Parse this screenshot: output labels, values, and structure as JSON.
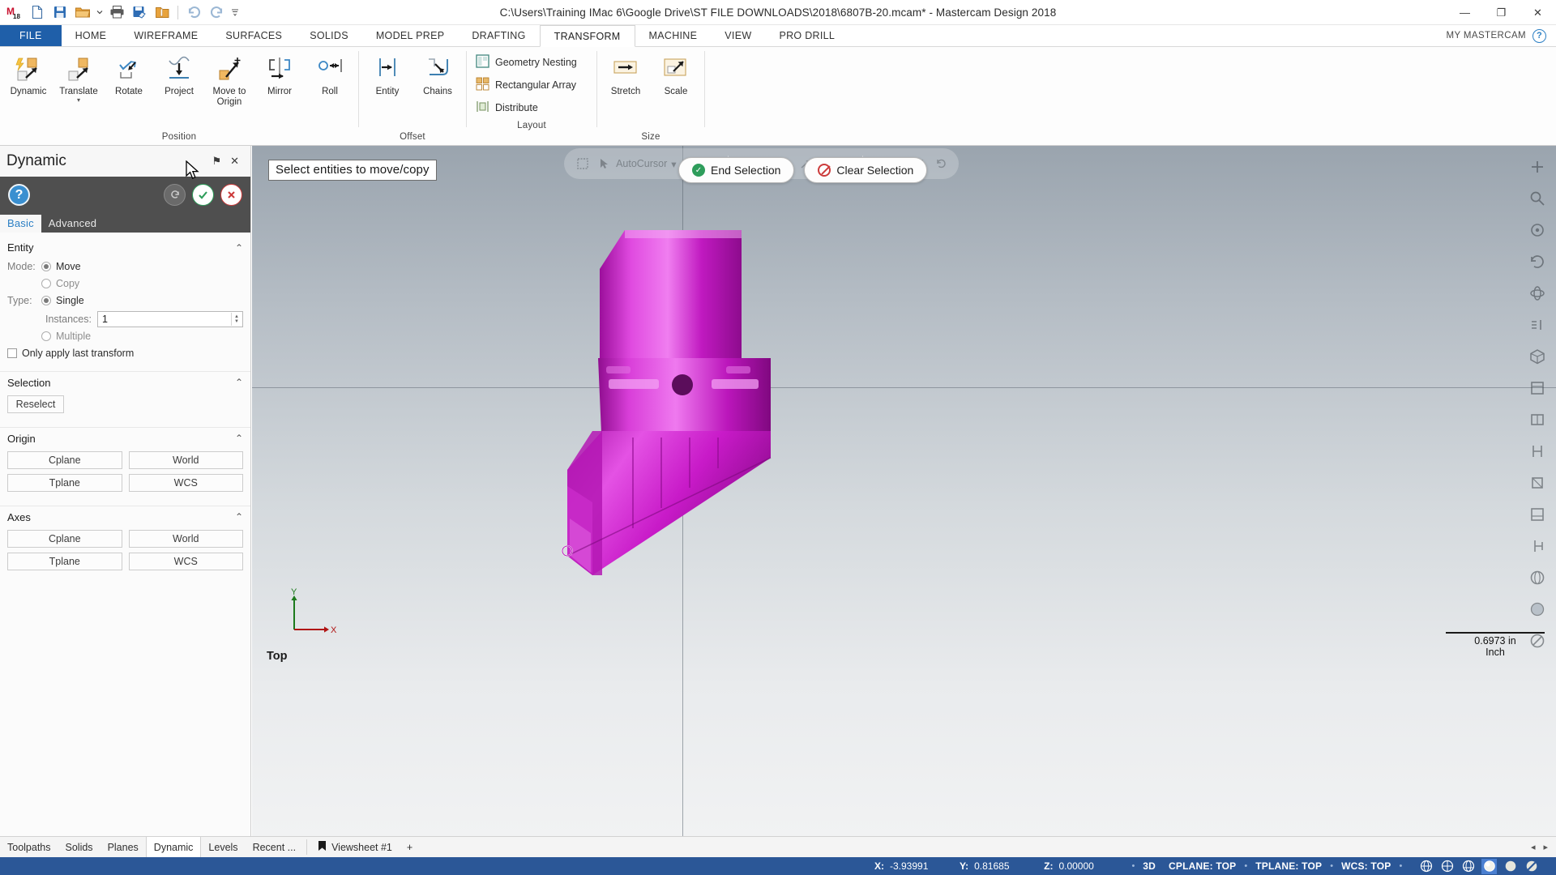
{
  "window": {
    "title": "C:\\Users\\Training IMac 6\\Google Drive\\ST FILE DOWNLOADS\\2018\\6807B-20.mcam* - Mastercam Design 2018",
    "minimize": "—",
    "maximize": "❐",
    "close": "✕"
  },
  "quick_access": [
    {
      "name": "mastercam-logo-icon",
      "label": "Mastercam 2018"
    },
    {
      "name": "new-file-icon",
      "label": "New"
    },
    {
      "name": "save-icon",
      "label": "Save"
    },
    {
      "name": "open-folder-icon",
      "label": "Open"
    },
    {
      "name": "open-dropdown-icon",
      "label": "Open recent"
    },
    {
      "name": "print-icon",
      "label": "Print"
    },
    {
      "name": "save-as-icon",
      "label": "Save As"
    },
    {
      "name": "zip2go-icon",
      "label": "Zip2Go"
    },
    {
      "name": "undo-icon",
      "label": "Undo"
    },
    {
      "name": "redo-icon",
      "label": "Redo"
    },
    {
      "name": "customize-qat-icon",
      "label": "Customize Quick Access Toolbar"
    }
  ],
  "ribbon": {
    "tabs": [
      {
        "label": "FILE",
        "kind": "file"
      },
      {
        "label": "HOME",
        "kind": "normal"
      },
      {
        "label": "WIREFRAME",
        "kind": "normal"
      },
      {
        "label": "SURFACES",
        "kind": "normal"
      },
      {
        "label": "SOLIDS",
        "kind": "normal"
      },
      {
        "label": "MODEL PREP",
        "kind": "normal"
      },
      {
        "label": "DRAFTING",
        "kind": "normal"
      },
      {
        "label": "TRANSFORM",
        "kind": "active"
      },
      {
        "label": "MACHINE",
        "kind": "normal"
      },
      {
        "label": "VIEW",
        "kind": "normal"
      },
      {
        "label": "PRO DRILL",
        "kind": "normal"
      }
    ],
    "my_mastercam": "MY MASTERCAM",
    "help_glyph": "?",
    "groups": [
      {
        "label": "Position",
        "buttons": [
          {
            "label": "Dynamic",
            "icon": "dynamic-icon",
            "dropdown": false
          },
          {
            "label": "Translate",
            "icon": "translate-icon",
            "dropdown": true
          },
          {
            "label": "Rotate",
            "icon": "rotate-icon",
            "dropdown": false
          },
          {
            "label": "Project",
            "icon": "project-icon",
            "dropdown": false
          },
          {
            "label": "Move to Origin",
            "icon": "move-to-origin-icon",
            "dropdown": false
          },
          {
            "label": "Mirror",
            "icon": "mirror-icon",
            "dropdown": false
          },
          {
            "label": "Roll",
            "icon": "roll-icon",
            "dropdown": false
          }
        ]
      },
      {
        "label": "Offset",
        "buttons": [
          {
            "label": "Entity",
            "icon": "offset-entity-icon",
            "dropdown": false
          },
          {
            "label": "Chains",
            "icon": "offset-chains-icon",
            "dropdown": false
          }
        ]
      },
      {
        "label": "Layout",
        "small_buttons": [
          {
            "label": "Geometry Nesting",
            "icon": "geometry-nesting-icon"
          },
          {
            "label": "Rectangular Array",
            "icon": "rectangular-array-icon"
          },
          {
            "label": "Distribute",
            "icon": "distribute-icon"
          }
        ]
      },
      {
        "label": "Size",
        "buttons": [
          {
            "label": "Stretch",
            "icon": "stretch-icon",
            "dropdown": false
          },
          {
            "label": "Scale",
            "icon": "scale-icon",
            "dropdown": false
          }
        ]
      }
    ]
  },
  "panel": {
    "title": "Dynamic",
    "pin_glyph": "⚑",
    "close_glyph": "✕",
    "help_glyph": "?",
    "ok_glyph": "✓",
    "cancel_glyph": "✕",
    "apply_glyph": "↺",
    "tabs": [
      {
        "label": "Basic",
        "selected": true
      },
      {
        "label": "Advanced",
        "selected": false
      }
    ],
    "entity": {
      "title": "Entity",
      "mode_label": "Mode:",
      "mode_move": "Move",
      "mode_copy": "Copy",
      "mode_selected": "Move",
      "type_label": "Type:",
      "type_single": "Single",
      "type_multiple": "Multiple",
      "type_selected": "Single",
      "instances_label": "Instances:",
      "instances_value": "1",
      "only_last_transform": "Only apply last transform",
      "only_last_checked": false
    },
    "selection": {
      "title": "Selection",
      "reselect": "Reselect"
    },
    "origin": {
      "title": "Origin",
      "buttons": [
        "Cplane",
        "World",
        "Tplane",
        "WCS"
      ]
    },
    "axes": {
      "title": "Axes",
      "buttons": [
        "Cplane",
        "World",
        "Tplane",
        "WCS"
      ]
    }
  },
  "viewport": {
    "prompt": "Select entities to move/copy",
    "end_selection": "End Selection",
    "clear_selection": "Clear Selection",
    "autocursor": "AutoCursor",
    "autocursor_caret": "▾",
    "view_name": "Top",
    "scale_value": "0.6973 in",
    "scale_unit": "Inch",
    "gnomon": {
      "x": "X",
      "y": "Y"
    },
    "model_color": "#d11fd1",
    "right_tools": [
      "fit-screen-icon",
      "zoom-window-icon",
      "zoom-target-icon",
      "unzoom-icon",
      "dynamic-rotate-icon",
      "pan-icon",
      "isometric-view-icon",
      "top-view-icon",
      "front-view-icon",
      "right-view-icon",
      "back-view-icon",
      "bottom-view-icon",
      "left-view-icon",
      "wireframe-shade-icon",
      "shaded-icon",
      "no-shade-icon"
    ]
  },
  "bottom_tabs": {
    "tabs": [
      {
        "label": "Toolpaths",
        "selected": false
      },
      {
        "label": "Solids",
        "selected": false
      },
      {
        "label": "Planes",
        "selected": false
      },
      {
        "label": "Dynamic",
        "selected": true
      },
      {
        "label": "Levels",
        "selected": false
      },
      {
        "label": "Recent ...",
        "selected": false
      }
    ],
    "viewsheet": "Viewsheet #1",
    "viewsheet_icon": "bookmark-icon",
    "add_viewsheet": "+",
    "nav_left": "◂",
    "nav_right": "▸"
  },
  "status_bar": {
    "x_label": "X:",
    "x_value": "-3.93991",
    "y_label": "Y:",
    "y_value": "0.81685",
    "z_label": "Z:",
    "z_value": "0.00000",
    "mode_3d": "3D",
    "cplane": "CPLANE: TOP",
    "tplane": "TPLANE: TOP",
    "wcs": "WCS: TOP",
    "separator": "•",
    "icons": [
      {
        "name": "wireframe-display-icon",
        "active": false
      },
      {
        "name": "hidden-lines-icon",
        "active": false
      },
      {
        "name": "shaded-wireframe-icon",
        "active": false
      },
      {
        "name": "shaded-display-icon",
        "active": true
      },
      {
        "name": "solid-shade-icon",
        "active": false
      },
      {
        "name": "translucency-icon",
        "active": false
      }
    ]
  }
}
